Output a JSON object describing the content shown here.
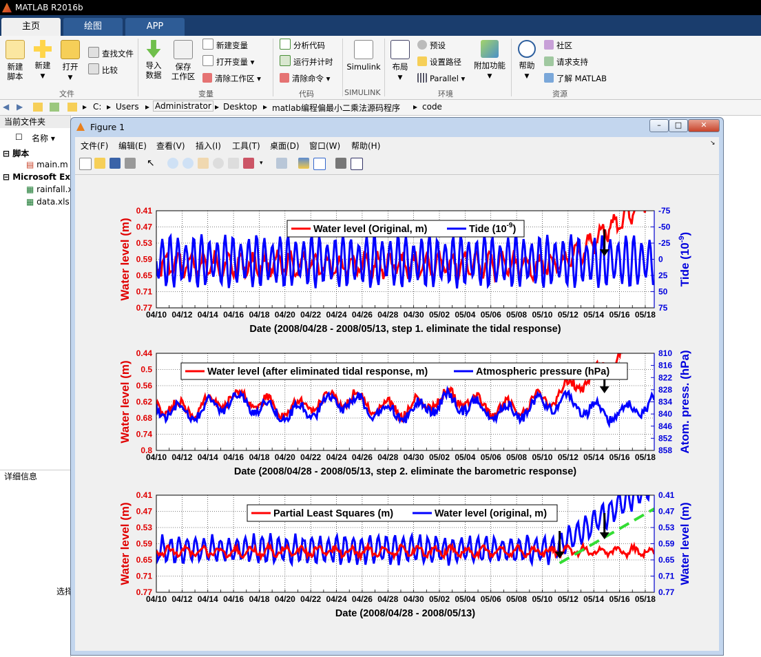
{
  "app": {
    "title": "MATLAB R2016b"
  },
  "tabs": [
    {
      "label": "主页"
    },
    {
      "label": "绘图"
    },
    {
      "label": "APP"
    }
  ],
  "ribbon": {
    "sections": [
      "文件",
      "变量",
      "代码",
      "SIMULINK",
      "环境",
      "资源"
    ],
    "new_script": "新建\n脚本",
    "new": "新建",
    "open": "打开",
    "find_files": "查找文件",
    "compare": "比较",
    "import_data": "导入\n数据",
    "save_workspace": "保存\n工作区",
    "new_variable": "新建变量",
    "open_variable": "打开变量",
    "clear_workspace": "清除工作区",
    "analyze_code": "分析代码",
    "run_and_time": "运行并计时",
    "clear_commands": "清除命令",
    "simulink": "Simulink",
    "layout": "布局",
    "preferences": "预设",
    "set_path": "设置路径",
    "parallel": "Parallel",
    "add_ons": "附加功能",
    "help": "帮助",
    "community": "社区",
    "request_support": "请求支持",
    "learn_matlab": "了解 MATLAB"
  },
  "path": [
    "C:",
    "Users",
    "Administrator",
    "Desktop",
    "matlab编程偏最小二乘法源码程序",
    "code"
  ],
  "left_panel": {
    "header": "当前文件夹",
    "col_name": "名称",
    "group_scripts": "脚本",
    "file_main": "main.m",
    "group_excel": "Microsoft Exc",
    "file_rainfall": "rainfall.x",
    "file_data": "data.xls",
    "details": "详细信息",
    "select": "选择"
  },
  "figure": {
    "title": "Figure 1",
    "menu": [
      "文件(F)",
      "编辑(E)",
      "查看(V)",
      "插入(I)",
      "工具(T)",
      "桌面(D)",
      "窗口(W)",
      "帮助(H)"
    ]
  },
  "chart_data": [
    {
      "type": "line",
      "x_ticks": [
        "04/10",
        "04/12",
        "04/14",
        "04/16",
        "04/18",
        "04/20",
        "04/22",
        "04/24",
        "04/26",
        "04/28",
        "04/30",
        "05/02",
        "05/04",
        "05/06",
        "05/08",
        "05/10",
        "05/12",
        "05/14",
        "05/16",
        "05/18"
      ],
      "xlabel": "Date (2008/04/28 - 2008/05/13, step 1. eliminate the tidal response)",
      "ylabel_left": "Water level (m)",
      "y_left_ticks": [
        "0.41",
        "0.47",
        "0.53",
        "0.59",
        "0.65",
        "0.71",
        "0.77"
      ],
      "ylabel_right": "Tide (10^-9)",
      "y_right_ticks": [
        "-75",
        "-50",
        "-25",
        "0",
        "25",
        "50",
        "75"
      ],
      "legend": [
        "Water level (Original, m)",
        "Tide (10^-9)"
      ],
      "series": [
        {
          "name": "Water level (Original, m)",
          "color": "#ff0000",
          "axis": "left",
          "trend": "oscillating around 0.61, rising above 0.41 after 05/13"
        },
        {
          "name": "Tide (10^-9)",
          "color": "#0000ff",
          "axis": "right",
          "trend": "oscillating between -15 and 60"
        }
      ]
    },
    {
      "type": "line",
      "x_ticks": [
        "04/10",
        "04/12",
        "04/14",
        "04/16",
        "04/18",
        "04/20",
        "04/22",
        "04/24",
        "04/26",
        "04/28",
        "04/30",
        "05/02",
        "05/04",
        "05/06",
        "05/08",
        "05/10",
        "05/12",
        "05/14",
        "05/16",
        "05/18"
      ],
      "xlabel": "Date (2008/04/28 - 2008/05/13, step 2. eliminate the barometric response)",
      "ylabel_left": "Water level (m)",
      "y_left_ticks": [
        "0.44",
        "0.5",
        "0.56",
        "0.62",
        "0.68",
        "0.74",
        "0.8"
      ],
      "ylabel_right": "Atom. press. (hPa)",
      "y_right_ticks": [
        "810",
        "816",
        "822",
        "828",
        "834",
        "840",
        "846",
        "852",
        "858"
      ],
      "legend": [
        "Water level (after eliminated tidal response, m)",
        "Atmospheric pressure (hPa)"
      ],
      "series": [
        {
          "name": "Water level (after eliminated tidal response, m)",
          "color": "#ff0000",
          "axis": "left"
        },
        {
          "name": "Atmospheric pressure (hPa)",
          "color": "#0000ff",
          "axis": "right"
        }
      ]
    },
    {
      "type": "line",
      "x_ticks": [
        "04/10",
        "04/12",
        "04/14",
        "04/16",
        "04/18",
        "04/20",
        "04/22",
        "04/24",
        "04/26",
        "04/28",
        "04/30",
        "05/02",
        "05/04",
        "05/06",
        "05/08",
        "05/10",
        "05/12",
        "05/14",
        "05/16",
        "05/18"
      ],
      "xlabel": "Date (2008/04/28 - 2008/05/13)",
      "ylabel_left": "Water level (m)",
      "y_left_ticks": [
        "0.41",
        "0.47",
        "0.53",
        "0.59",
        "0.65",
        "0.71",
        "0.77"
      ],
      "ylabel_right": "Water level (m)",
      "y_right_ticks": [
        "0.41",
        "0.47",
        "0.53",
        "0.59",
        "0.65",
        "0.71",
        "0.77"
      ],
      "legend": [
        "Partial Least Squares (m)",
        "Water level (original, m)"
      ],
      "series": [
        {
          "name": "Partial Least Squares (m)",
          "color": "#ff0000",
          "axis": "left"
        },
        {
          "name": "Water level (original, m)",
          "color": "#0000ff",
          "axis": "right"
        }
      ]
    }
  ]
}
